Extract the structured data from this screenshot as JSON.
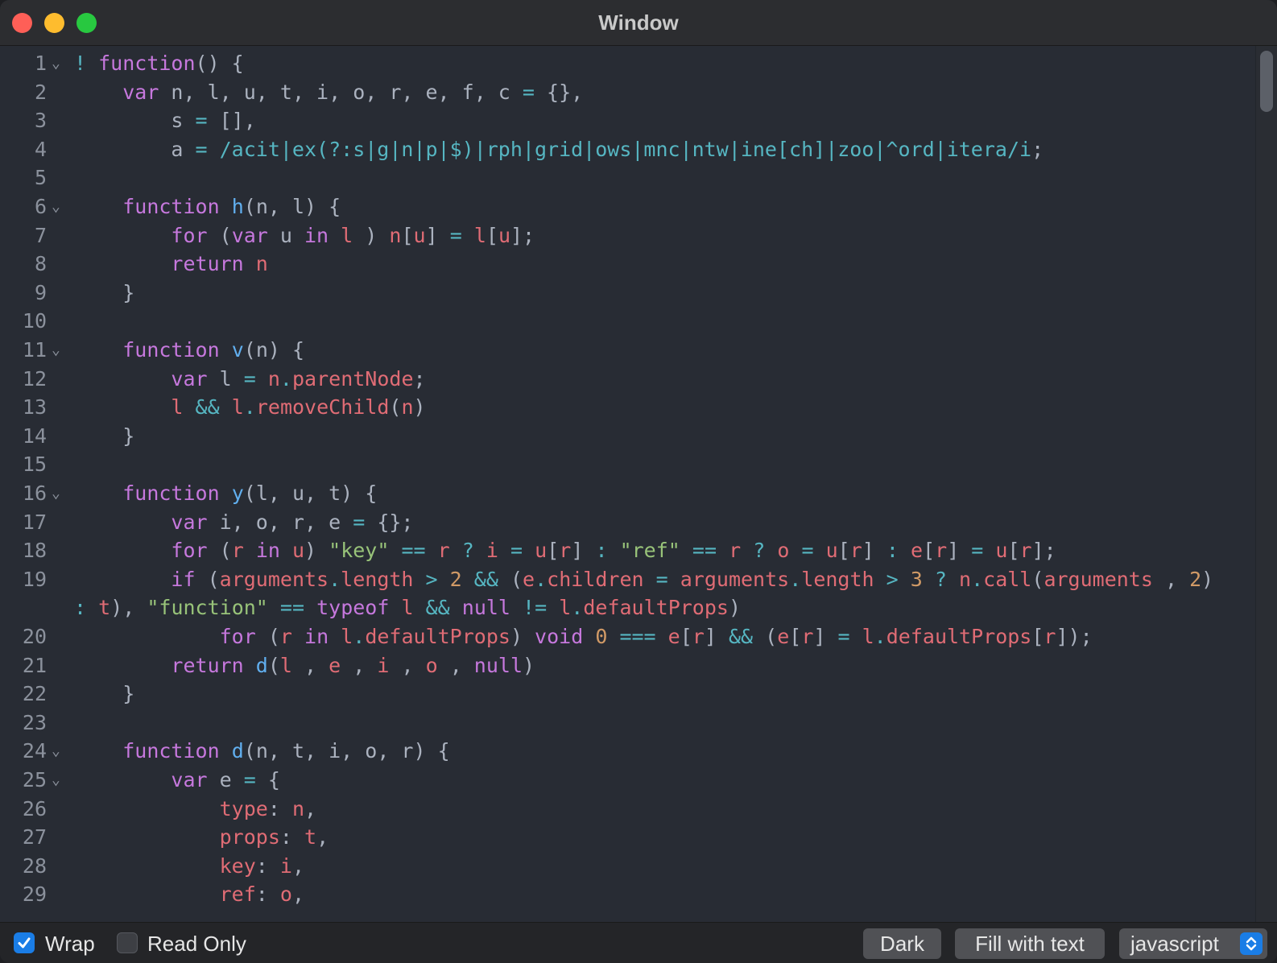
{
  "window": {
    "title": "Window"
  },
  "lines": [
    {
      "n": "1",
      "fold": true,
      "tokens": [
        [
          "op",
          "! "
        ],
        [
          "kw",
          "function"
        ],
        [
          "",
          "() {"
        ]
      ]
    },
    {
      "n": "2",
      "fold": false,
      "tokens": [
        [
          "",
          "    "
        ],
        [
          "kw",
          "var"
        ],
        [
          "",
          " n, l, u, t, i, o, r, e, f, c "
        ],
        [
          "op",
          "="
        ],
        [
          "",
          " {},"
        ]
      ]
    },
    {
      "n": "3",
      "fold": false,
      "tokens": [
        [
          "",
          "        s "
        ],
        [
          "op",
          "="
        ],
        [
          "",
          " [],"
        ]
      ]
    },
    {
      "n": "4",
      "fold": false,
      "tokens": [
        [
          "",
          "        a "
        ],
        [
          "op",
          "="
        ],
        [
          "rx",
          " /acit|ex(?:s|g|n|p|$)|rph|grid|ows|mnc|ntw|ine[ch]|zoo|^ord|itera/i"
        ],
        [
          "",
          ";"
        ]
      ]
    },
    {
      "n": "5",
      "fold": false,
      "tokens": []
    },
    {
      "n": "6",
      "fold": true,
      "tokens": [
        [
          "",
          "    "
        ],
        [
          "kw",
          "function"
        ],
        [
          "",
          " "
        ],
        [
          "fn",
          "h"
        ],
        [
          "",
          "(n, l) {"
        ]
      ]
    },
    {
      "n": "7",
      "fold": false,
      "tokens": [
        [
          "",
          "        "
        ],
        [
          "kw",
          "for"
        ],
        [
          "",
          " ("
        ],
        [
          "kw",
          "var"
        ],
        [
          "",
          " u "
        ],
        [
          "kw",
          "in"
        ],
        [
          "",
          " "
        ],
        [
          "vr",
          "l"
        ],
        [
          "",
          " ) "
        ],
        [
          "vr",
          "n"
        ],
        [
          "",
          "["
        ],
        [
          "vr",
          "u"
        ],
        [
          "",
          "] "
        ],
        [
          "op",
          "="
        ],
        [
          "",
          " "
        ],
        [
          "vr",
          "l"
        ],
        [
          "",
          "["
        ],
        [
          "vr",
          "u"
        ],
        [
          "",
          "];"
        ]
      ]
    },
    {
      "n": "8",
      "fold": false,
      "tokens": [
        [
          "",
          "        "
        ],
        [
          "kw",
          "return"
        ],
        [
          "",
          " "
        ],
        [
          "vr",
          "n"
        ]
      ]
    },
    {
      "n": "9",
      "fold": false,
      "tokens": [
        [
          "",
          "    }"
        ]
      ]
    },
    {
      "n": "10",
      "fold": false,
      "tokens": []
    },
    {
      "n": "11",
      "fold": true,
      "tokens": [
        [
          "",
          "    "
        ],
        [
          "kw",
          "function"
        ],
        [
          "",
          " "
        ],
        [
          "fn",
          "v"
        ],
        [
          "",
          "(n) {"
        ]
      ]
    },
    {
      "n": "12",
      "fold": false,
      "tokens": [
        [
          "",
          "        "
        ],
        [
          "kw",
          "var"
        ],
        [
          "",
          " l "
        ],
        [
          "op",
          "="
        ],
        [
          "",
          " "
        ],
        [
          "vr",
          "n"
        ],
        [
          "op",
          "."
        ],
        [
          "vr",
          "parentNode"
        ],
        [
          "",
          ";"
        ]
      ]
    },
    {
      "n": "13",
      "fold": false,
      "tokens": [
        [
          "",
          "        "
        ],
        [
          "vr",
          "l"
        ],
        [
          "",
          " "
        ],
        [
          "op",
          "&&"
        ],
        [
          "",
          " "
        ],
        [
          "vr",
          "l"
        ],
        [
          "op",
          "."
        ],
        [
          "vr",
          "removeChild"
        ],
        [
          "",
          "("
        ],
        [
          "vr",
          "n"
        ],
        [
          "",
          ")"
        ]
      ]
    },
    {
      "n": "14",
      "fold": false,
      "tokens": [
        [
          "",
          "    }"
        ]
      ]
    },
    {
      "n": "15",
      "fold": false,
      "tokens": []
    },
    {
      "n": "16",
      "fold": true,
      "tokens": [
        [
          "",
          "    "
        ],
        [
          "kw",
          "function"
        ],
        [
          "",
          " "
        ],
        [
          "fn",
          "y"
        ],
        [
          "",
          "(l, u, t) {"
        ]
      ]
    },
    {
      "n": "17",
      "fold": false,
      "tokens": [
        [
          "",
          "        "
        ],
        [
          "kw",
          "var"
        ],
        [
          "",
          " i, o, r, e "
        ],
        [
          "op",
          "="
        ],
        [
          "",
          " {};"
        ]
      ]
    },
    {
      "n": "18",
      "fold": false,
      "tokens": [
        [
          "",
          "        "
        ],
        [
          "kw",
          "for"
        ],
        [
          "",
          " ("
        ],
        [
          "vr",
          "r"
        ],
        [
          "",
          " "
        ],
        [
          "kw",
          "in"
        ],
        [
          "",
          " "
        ],
        [
          "vr",
          "u"
        ],
        [
          "",
          ") "
        ],
        [
          "st",
          "\"key\""
        ],
        [
          "",
          " "
        ],
        [
          "op",
          "=="
        ],
        [
          "",
          " "
        ],
        [
          "vr",
          "r"
        ],
        [
          "",
          " "
        ],
        [
          "op",
          "?"
        ],
        [
          "",
          " "
        ],
        [
          "vr",
          "i"
        ],
        [
          "",
          " "
        ],
        [
          "op",
          "="
        ],
        [
          "",
          " "
        ],
        [
          "vr",
          "u"
        ],
        [
          "",
          "["
        ],
        [
          "vr",
          "r"
        ],
        [
          "",
          "] "
        ],
        [
          "op",
          ":"
        ],
        [
          "",
          " "
        ],
        [
          "st",
          "\"ref\""
        ],
        [
          "",
          " "
        ],
        [
          "op",
          "=="
        ],
        [
          "",
          " "
        ],
        [
          "vr",
          "r"
        ],
        [
          "",
          " "
        ],
        [
          "op",
          "?"
        ],
        [
          "",
          " "
        ],
        [
          "vr",
          "o"
        ],
        [
          "",
          " "
        ],
        [
          "op",
          "="
        ],
        [
          "",
          " "
        ],
        [
          "vr",
          "u"
        ],
        [
          "",
          "["
        ],
        [
          "vr",
          "r"
        ],
        [
          "",
          "] "
        ],
        [
          "op",
          ":"
        ],
        [
          "",
          " "
        ],
        [
          "vr",
          "e"
        ],
        [
          "",
          "["
        ],
        [
          "vr",
          "r"
        ],
        [
          "",
          "] "
        ],
        [
          "op",
          "="
        ],
        [
          "",
          " "
        ],
        [
          "vr",
          "u"
        ],
        [
          "",
          "["
        ],
        [
          "vr",
          "r"
        ],
        [
          "",
          "];"
        ]
      ]
    },
    {
      "n": "19",
      "fold": false,
      "tokens": [
        [
          "",
          "        "
        ],
        [
          "kw",
          "if"
        ],
        [
          "",
          " ("
        ],
        [
          "vr",
          "arguments"
        ],
        [
          "op",
          "."
        ],
        [
          "vr",
          "length"
        ],
        [
          "",
          " "
        ],
        [
          "op",
          ">"
        ],
        [
          "",
          " "
        ],
        [
          "nu",
          "2"
        ],
        [
          "",
          " "
        ],
        [
          "op",
          "&&"
        ],
        [
          "",
          " ("
        ],
        [
          "vr",
          "e"
        ],
        [
          "op",
          "."
        ],
        [
          "vr",
          "children"
        ],
        [
          "",
          " "
        ],
        [
          "op",
          "="
        ],
        [
          "",
          " "
        ],
        [
          "vr",
          "arguments"
        ],
        [
          "op",
          "."
        ],
        [
          "vr",
          "length"
        ],
        [
          "",
          " "
        ],
        [
          "op",
          ">"
        ],
        [
          "",
          " "
        ],
        [
          "nu",
          "3"
        ],
        [
          "",
          " "
        ],
        [
          "op",
          "?"
        ],
        [
          "",
          " "
        ],
        [
          "vr",
          "n"
        ],
        [
          "op",
          "."
        ],
        [
          "vr",
          "call"
        ],
        [
          "",
          "("
        ],
        [
          "vr",
          "arguments"
        ],
        [
          "",
          " , "
        ],
        [
          "nu",
          "2"
        ],
        [
          "",
          ")"
        ]
      ]
    },
    {
      "n": "",
      "fold": false,
      "tokens": [
        [
          "op",
          ":"
        ],
        [
          "",
          " "
        ],
        [
          "vr",
          "t"
        ],
        [
          "",
          "), "
        ],
        [
          "st",
          "\"function\""
        ],
        [
          "",
          " "
        ],
        [
          "op",
          "=="
        ],
        [
          "",
          " "
        ],
        [
          "kw",
          "typeof"
        ],
        [
          "",
          " "
        ],
        [
          "vr",
          "l"
        ],
        [
          "",
          " "
        ],
        [
          "op",
          "&&"
        ],
        [
          "",
          " "
        ],
        [
          "kw",
          "null"
        ],
        [
          "",
          " "
        ],
        [
          "op",
          "!="
        ],
        [
          "",
          " "
        ],
        [
          "vr",
          "l"
        ],
        [
          "op",
          "."
        ],
        [
          "vr",
          "defaultProps"
        ],
        [
          "",
          ")"
        ]
      ]
    },
    {
      "n": "20",
      "fold": false,
      "tokens": [
        [
          "",
          "            "
        ],
        [
          "kw",
          "for"
        ],
        [
          "",
          " ("
        ],
        [
          "vr",
          "r"
        ],
        [
          "",
          " "
        ],
        [
          "kw",
          "in"
        ],
        [
          "",
          " "
        ],
        [
          "vr",
          "l"
        ],
        [
          "op",
          "."
        ],
        [
          "vr",
          "defaultProps"
        ],
        [
          "",
          ") "
        ],
        [
          "kw",
          "void"
        ],
        [
          "",
          " "
        ],
        [
          "nu",
          "0"
        ],
        [
          "",
          " "
        ],
        [
          "op",
          "==="
        ],
        [
          "",
          " "
        ],
        [
          "vr",
          "e"
        ],
        [
          "",
          "["
        ],
        [
          "vr",
          "r"
        ],
        [
          "",
          "] "
        ],
        [
          "op",
          "&&"
        ],
        [
          "",
          " ("
        ],
        [
          "vr",
          "e"
        ],
        [
          "",
          "["
        ],
        [
          "vr",
          "r"
        ],
        [
          "",
          "] "
        ],
        [
          "op",
          "="
        ],
        [
          "",
          " "
        ],
        [
          "vr",
          "l"
        ],
        [
          "op",
          "."
        ],
        [
          "vr",
          "defaultProps"
        ],
        [
          "",
          "["
        ],
        [
          "vr",
          "r"
        ],
        [
          "",
          "]);"
        ]
      ]
    },
    {
      "n": "21",
      "fold": false,
      "tokens": [
        [
          "",
          "        "
        ],
        [
          "kw",
          "return"
        ],
        [
          "",
          " "
        ],
        [
          "fn",
          "d"
        ],
        [
          "",
          "("
        ],
        [
          "vr",
          "l"
        ],
        [
          "",
          " , "
        ],
        [
          "vr",
          "e"
        ],
        [
          "",
          " , "
        ],
        [
          "vr",
          "i"
        ],
        [
          "",
          " , "
        ],
        [
          "vr",
          "o"
        ],
        [
          "",
          " , "
        ],
        [
          "kw",
          "null"
        ],
        [
          "",
          ")"
        ]
      ]
    },
    {
      "n": "22",
      "fold": false,
      "tokens": [
        [
          "",
          "    }"
        ]
      ]
    },
    {
      "n": "23",
      "fold": false,
      "tokens": []
    },
    {
      "n": "24",
      "fold": true,
      "tokens": [
        [
          "",
          "    "
        ],
        [
          "kw",
          "function"
        ],
        [
          "",
          " "
        ],
        [
          "fn",
          "d"
        ],
        [
          "",
          "(n, t, i, o, r) {"
        ]
      ]
    },
    {
      "n": "25",
      "fold": true,
      "tokens": [
        [
          "",
          "        "
        ],
        [
          "kw",
          "var"
        ],
        [
          "",
          " e "
        ],
        [
          "op",
          "="
        ],
        [
          "",
          " {"
        ]
      ]
    },
    {
      "n": "26",
      "fold": false,
      "tokens": [
        [
          "",
          "            "
        ],
        [
          "vr",
          "type"
        ],
        [
          "",
          ": "
        ],
        [
          "vr",
          "n"
        ],
        [
          "",
          ","
        ]
      ]
    },
    {
      "n": "27",
      "fold": false,
      "tokens": [
        [
          "",
          "            "
        ],
        [
          "vr",
          "props"
        ],
        [
          "",
          ": "
        ],
        [
          "vr",
          "t"
        ],
        [
          "",
          ","
        ]
      ]
    },
    {
      "n": "28",
      "fold": false,
      "tokens": [
        [
          "",
          "            "
        ],
        [
          "vr",
          "key"
        ],
        [
          "",
          ": "
        ],
        [
          "vr",
          "i"
        ],
        [
          "",
          ","
        ]
      ]
    },
    {
      "n": "29",
      "fold": false,
      "tokens": [
        [
          "",
          "            "
        ],
        [
          "vr",
          "ref"
        ],
        [
          "",
          ": "
        ],
        [
          "vr",
          "o"
        ],
        [
          "",
          ","
        ]
      ]
    }
  ],
  "toolbar": {
    "wrap_label": "Wrap",
    "wrap_checked": true,
    "readonly_label": "Read Only",
    "readonly_checked": false,
    "dark_label": "Dark",
    "fill_label": "Fill with text",
    "language_selected": "javascript"
  }
}
